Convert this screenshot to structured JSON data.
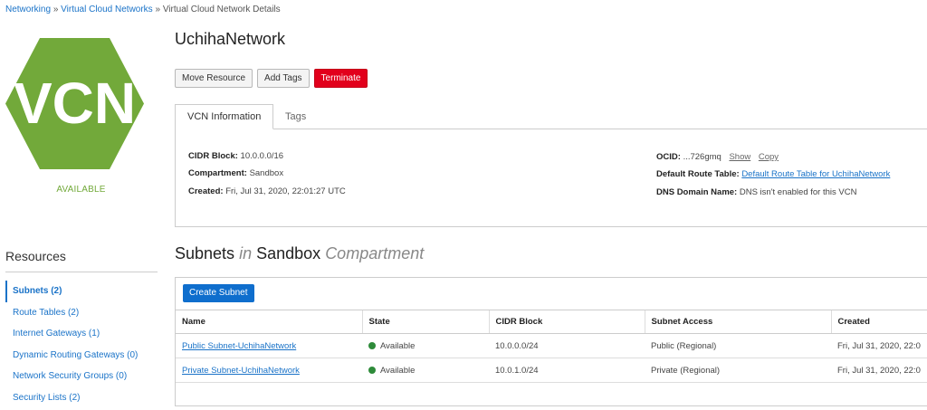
{
  "breadcrumb": {
    "items": [
      "Networking",
      "Virtual Cloud Networks",
      "Virtual Cloud Network Details"
    ],
    "separator": "»"
  },
  "vcn": {
    "logo_text": "VCN",
    "logo_color": "#72a93a",
    "status": "AVAILABLE",
    "name": "UchihaNetwork"
  },
  "actions": {
    "move": "Move Resource",
    "add_tags": "Add Tags",
    "terminate": "Terminate"
  },
  "tabs": [
    "VCN Information",
    "Tags"
  ],
  "info": {
    "cidr_label": "CIDR Block:",
    "cidr_value": "10.0.0.0/16",
    "compartment_label": "Compartment:",
    "compartment_value": "Sandbox",
    "created_label": "Created:",
    "created_value": "Fri, Jul 31, 2020, 22:01:27 UTC",
    "ocid_label": "OCID:",
    "ocid_value": "...726gmq",
    "ocid_show": "Show",
    "ocid_copy": "Copy",
    "route_label": "Default Route Table:",
    "route_value": "Default Route Table for UchihaNetwork",
    "dns_label": "DNS Domain Name:",
    "dns_value": "DNS isn't enabled for this VCN"
  },
  "resources": {
    "title": "Resources",
    "items": [
      {
        "label": "Subnets (2)"
      },
      {
        "label": "Route Tables (2)"
      },
      {
        "label": "Internet Gateways (1)"
      },
      {
        "label": "Dynamic Routing Gateways (0)"
      },
      {
        "label": "Network Security Groups (0)"
      },
      {
        "label": "Security Lists (2)"
      }
    ]
  },
  "subnets": {
    "title_main": "Subnets",
    "title_in": "in",
    "title_compartment": "Sandbox",
    "title_suffix": "Compartment",
    "create_button": "Create Subnet",
    "columns": [
      "Name",
      "State",
      "CIDR Block",
      "Subnet Access",
      "Created"
    ],
    "rows": [
      {
        "name": "Public Subnet-UchihaNetwork",
        "state": "Available",
        "cidr": "10.0.0.0/24",
        "access": "Public (Regional)",
        "created": "Fri, Jul 31, 2020, 22:0"
      },
      {
        "name": "Private Subnet-UchihaNetwork",
        "state": "Available",
        "cidr": "10.0.1.0/24",
        "access": "Private (Regional)",
        "created": "Fri, Jul 31, 2020, 22:0"
      }
    ],
    "state_color": "#2e8b3a"
  },
  "colors": {
    "link": "#1a73c8",
    "danger": "#e2001c",
    "primary": "#0f6ecd"
  }
}
